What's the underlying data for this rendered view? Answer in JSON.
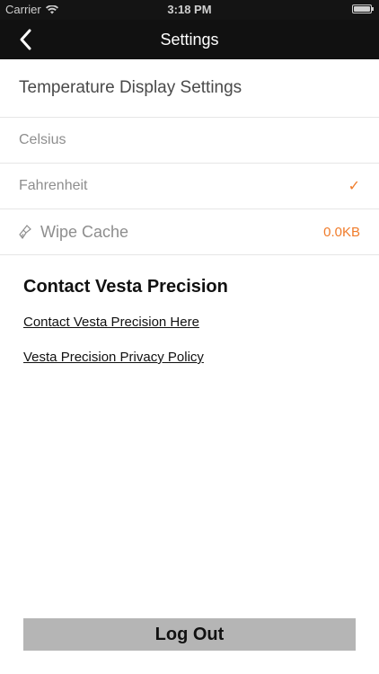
{
  "status_bar": {
    "carrier": "Carrier",
    "time": "3:18 PM"
  },
  "navbar": {
    "title": "Settings",
    "back_icon": "chevron-left-icon"
  },
  "temperature": {
    "header": "Temperature Display Settings",
    "options": [
      {
        "label": "Celsius",
        "selected": false
      },
      {
        "label": "Fahrenheit",
        "selected": true
      }
    ],
    "check_mark": "✓"
  },
  "cache": {
    "label": "Wipe Cache",
    "size": "0.0KB",
    "icon": "brush-icon"
  },
  "contact": {
    "title": "Contact Vesta Precision",
    "link_contact": "Contact Vesta Precision Here",
    "link_privacy": "Vesta Precision Privacy Policy"
  },
  "logout_label": "Log Out",
  "colors": {
    "accent": "#f07c2b",
    "navbar": "#111111",
    "logout_bg": "#b5b5b5"
  }
}
